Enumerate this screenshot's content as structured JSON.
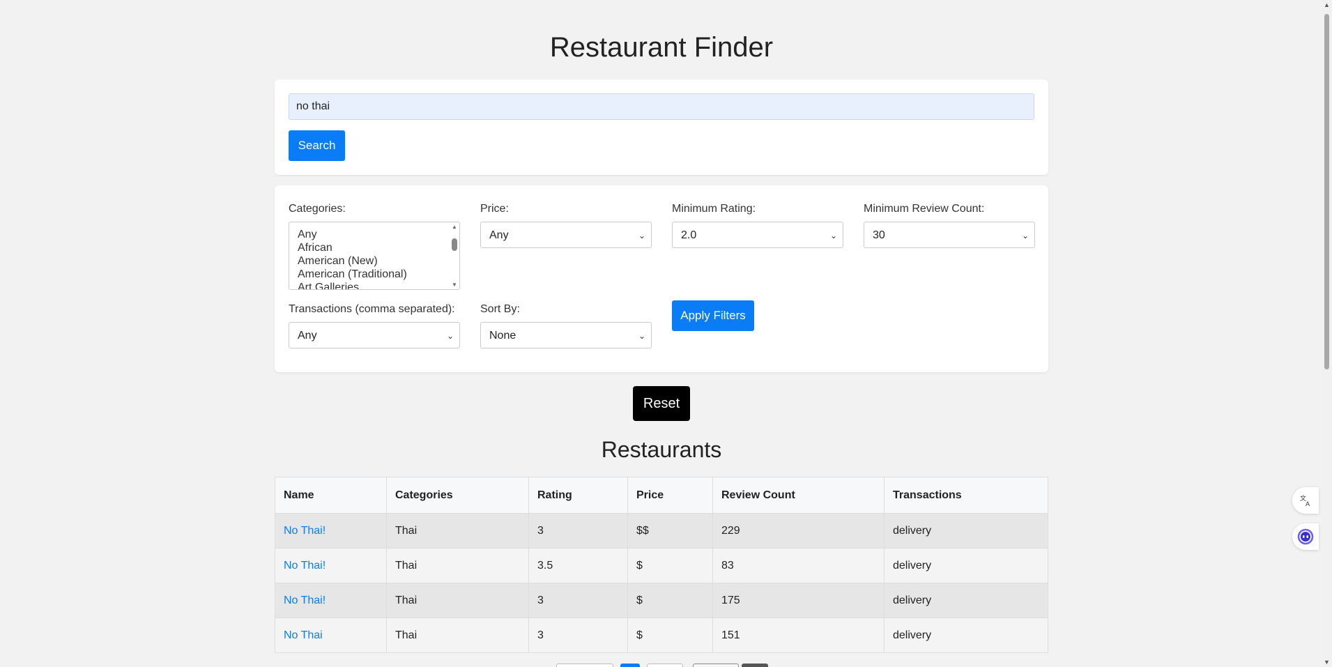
{
  "header": {
    "title": "Restaurant Finder"
  },
  "search": {
    "value": "no thai",
    "button_label": "Search"
  },
  "filters": {
    "categories": {
      "label": "Categories:",
      "options": [
        "Any",
        "African",
        "American (New)",
        "American (Traditional)",
        "Art Galleries"
      ]
    },
    "price": {
      "label": "Price:",
      "selected": "Any"
    },
    "min_rating": {
      "label": "Minimum Rating:",
      "selected": "2.0"
    },
    "min_review_count": {
      "label": "Minimum Review Count:",
      "selected": "30"
    },
    "transactions": {
      "label": "Transactions (comma separated):",
      "selected": "Any"
    },
    "sort_by": {
      "label": "Sort By:",
      "selected": "None"
    },
    "apply_label": "Apply Filters"
  },
  "reset_label": "Reset",
  "results": {
    "title": "Restaurants",
    "columns": [
      "Name",
      "Categories",
      "Rating",
      "Price",
      "Review Count",
      "Transactions"
    ],
    "rows": [
      {
        "name": "No Thai!",
        "categories": "Thai",
        "rating": "3",
        "price": "$$",
        "review_count": "229",
        "transactions": "delivery"
      },
      {
        "name": "No Thai!",
        "categories": "Thai",
        "rating": "3.5",
        "price": "$",
        "review_count": "83",
        "transactions": "delivery"
      },
      {
        "name": "No Thai!",
        "categories": "Thai",
        "rating": "3",
        "price": "$",
        "review_count": "175",
        "transactions": "delivery"
      },
      {
        "name": "No Thai",
        "categories": "Thai",
        "rating": "3",
        "price": "$",
        "review_count": "151",
        "transactions": "delivery"
      }
    ]
  },
  "colors": {
    "accent": "#0a7cf5",
    "reset": "#000000",
    "background": "#f2f2f2"
  },
  "icons": {
    "translate": "translate-icon",
    "assistant": "assistant-icon",
    "dropdown": "chevron-down-icon"
  }
}
